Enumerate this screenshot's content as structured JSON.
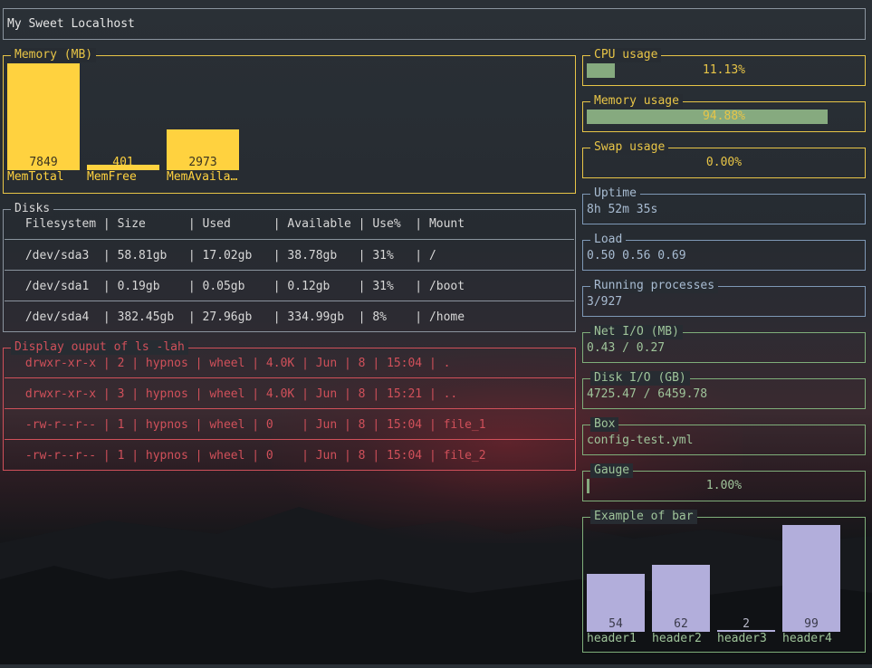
{
  "title": "My Sweet Localhost",
  "memory": {
    "title": "Memory (MB)",
    "max": 7849,
    "bars": [
      {
        "label": "MemTotal",
        "value": 7849
      },
      {
        "label": "MemFree",
        "value": 401
      },
      {
        "label": "MemAvaila…",
        "value": 2973
      }
    ]
  },
  "disks": {
    "title": "Disks",
    "header": " Filesystem | Size      | Used      | Available | Use%  | Mount",
    "rows": [
      " /dev/sda3  | 58.81gb   | 17.02gb   | 38.78gb   | 31%   | /",
      " /dev/sda1  | 0.19gb    | 0.05gb    | 0.12gb    | 31%   | /boot",
      " /dev/sda4  | 382.45gb  | 27.96gb   | 334.99gb  | 8%    | /home"
    ]
  },
  "ls": {
    "title": "Display ouput of ls -lah",
    "rows": [
      " drwxr-xr-x | 2 | hypnos | wheel | 4.0K | Jun | 8 | 15:04 | .",
      " drwxr-xr-x | 3 | hypnos | wheel | 4.0K | Jun | 8 | 15:21 | ..",
      " -rw-r--r-- | 1 | hypnos | wheel | 0    | Jun | 8 | 15:04 | file_1",
      " -rw-r--r-- | 1 | hypnos | wheel | 0    | Jun | 8 | 15:04 | file_2"
    ]
  },
  "cpu": {
    "title": "CPU usage",
    "text": "11.13%",
    "percent": 11.13
  },
  "mem_usage": {
    "title": "Memory usage",
    "text": "94.88%",
    "percent": 94.88
  },
  "swap": {
    "title": "Swap usage",
    "text": "0.00%",
    "percent": 0
  },
  "uptime": {
    "title": "Uptime",
    "text": "8h 52m 35s"
  },
  "load": {
    "title": "Load",
    "text": "0.50 0.56 0.69"
  },
  "procs": {
    "title": "Running processes",
    "text": "3/927"
  },
  "netio": {
    "title": "Net I/O (MB)",
    "text": "0.43 / 0.27"
  },
  "diskio": {
    "title": "Disk I/O (GB)",
    "text": "4725.47 / 6459.78"
  },
  "box": {
    "title": "Box",
    "text": "config-test.yml"
  },
  "gauge": {
    "title": "Gauge",
    "text": "1.00%",
    "percent": 1
  },
  "example_bar": {
    "title": "Example of bar",
    "max": 99,
    "bars": [
      {
        "label": "header1",
        "value": 54
      },
      {
        "label": "header2",
        "value": 62
      },
      {
        "label": "header3",
        "value": 2
      },
      {
        "label": "header4",
        "value": 99
      }
    ]
  },
  "colors": {
    "yellow": "#e8c547",
    "blue": "#7e98b6",
    "red": "#d0505a",
    "green": "#7fae7a",
    "gauge_fill": "#86aa7f",
    "bar_lavender": "#b2aedb",
    "memory_bar": "#ffd23f"
  }
}
